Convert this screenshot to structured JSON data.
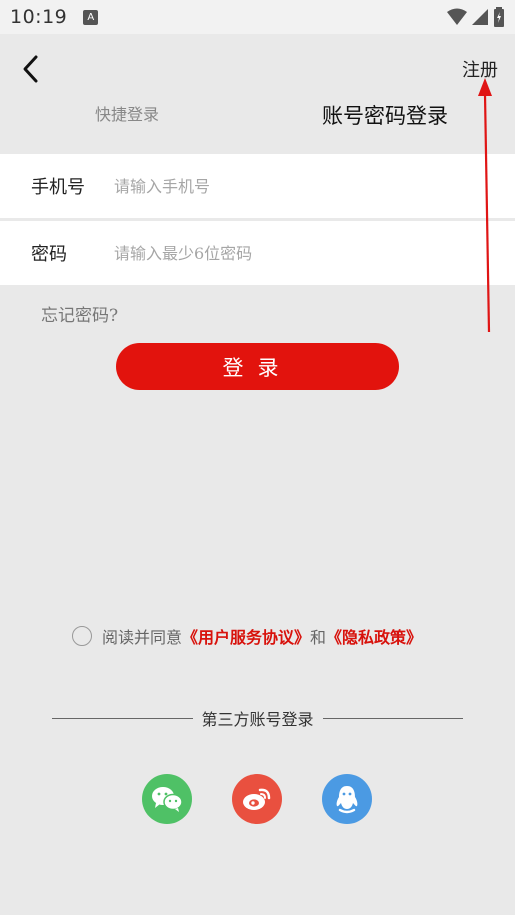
{
  "status_bar": {
    "time": "10:19",
    "badge": "A"
  },
  "header": {
    "register_label": "注册"
  },
  "tabs": [
    {
      "label": "快捷登录",
      "active": false
    },
    {
      "label": "账号密码登录",
      "active": true
    }
  ],
  "form": {
    "phone": {
      "label": "手机号",
      "placeholder": "请输入手机号",
      "value": ""
    },
    "password": {
      "label": "密码",
      "placeholder": "请输入最少6位密码",
      "value": ""
    },
    "forgot_label": "忘记密码?",
    "login_label": "登录"
  },
  "agreement": {
    "prefix": "阅读并同意",
    "terms_label": "《用户服务协议》",
    "conjunction": "和",
    "privacy_label": "《隐私政策》",
    "checked": false
  },
  "third_party": {
    "title": "第三方账号登录",
    "providers": [
      {
        "name": "wechat-icon",
        "color": "#4fc166"
      },
      {
        "name": "weibo-icon",
        "color": "#e9503f"
      },
      {
        "name": "qq-icon",
        "color": "#4b9ae3"
      }
    ]
  },
  "colors": {
    "accent": "#e2130d",
    "link": "#d8120c",
    "background": "#e9e9e9"
  }
}
